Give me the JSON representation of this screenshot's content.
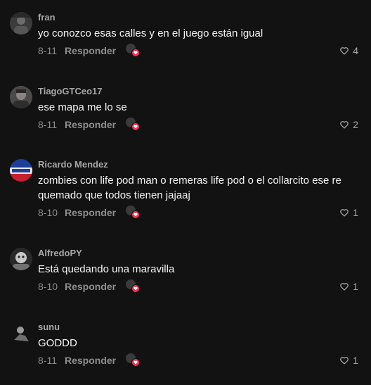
{
  "reply_label": "Responder",
  "icons": {
    "like": "heart-outline-icon",
    "creator_like": "creator-liked-badge-icon"
  },
  "colors": {
    "background": "#121212",
    "creator_heart": "#fe2c55"
  },
  "comments": [
    {
      "username": "fran",
      "text": "yo conozco esas calles y en el juego están igual",
      "date": "8-11",
      "likes": "4"
    },
    {
      "username": "TiagoGTCeo17",
      "text": "ese mapa me lo se",
      "date": "8-11",
      "likes": "2"
    },
    {
      "username": "Ricardo Mendez",
      "text": "zombies con life pod man o remeras life pod o el collarcito ese re quemado que todos tienen jajaaj",
      "date": "8-10",
      "likes": "1"
    },
    {
      "username": "AlfredoPY",
      "text": "Está quedando una maravilla",
      "date": "8-10",
      "likes": "1"
    },
    {
      "username": "sunu",
      "text": "GODDD",
      "date": "8-11",
      "likes": "1"
    }
  ]
}
